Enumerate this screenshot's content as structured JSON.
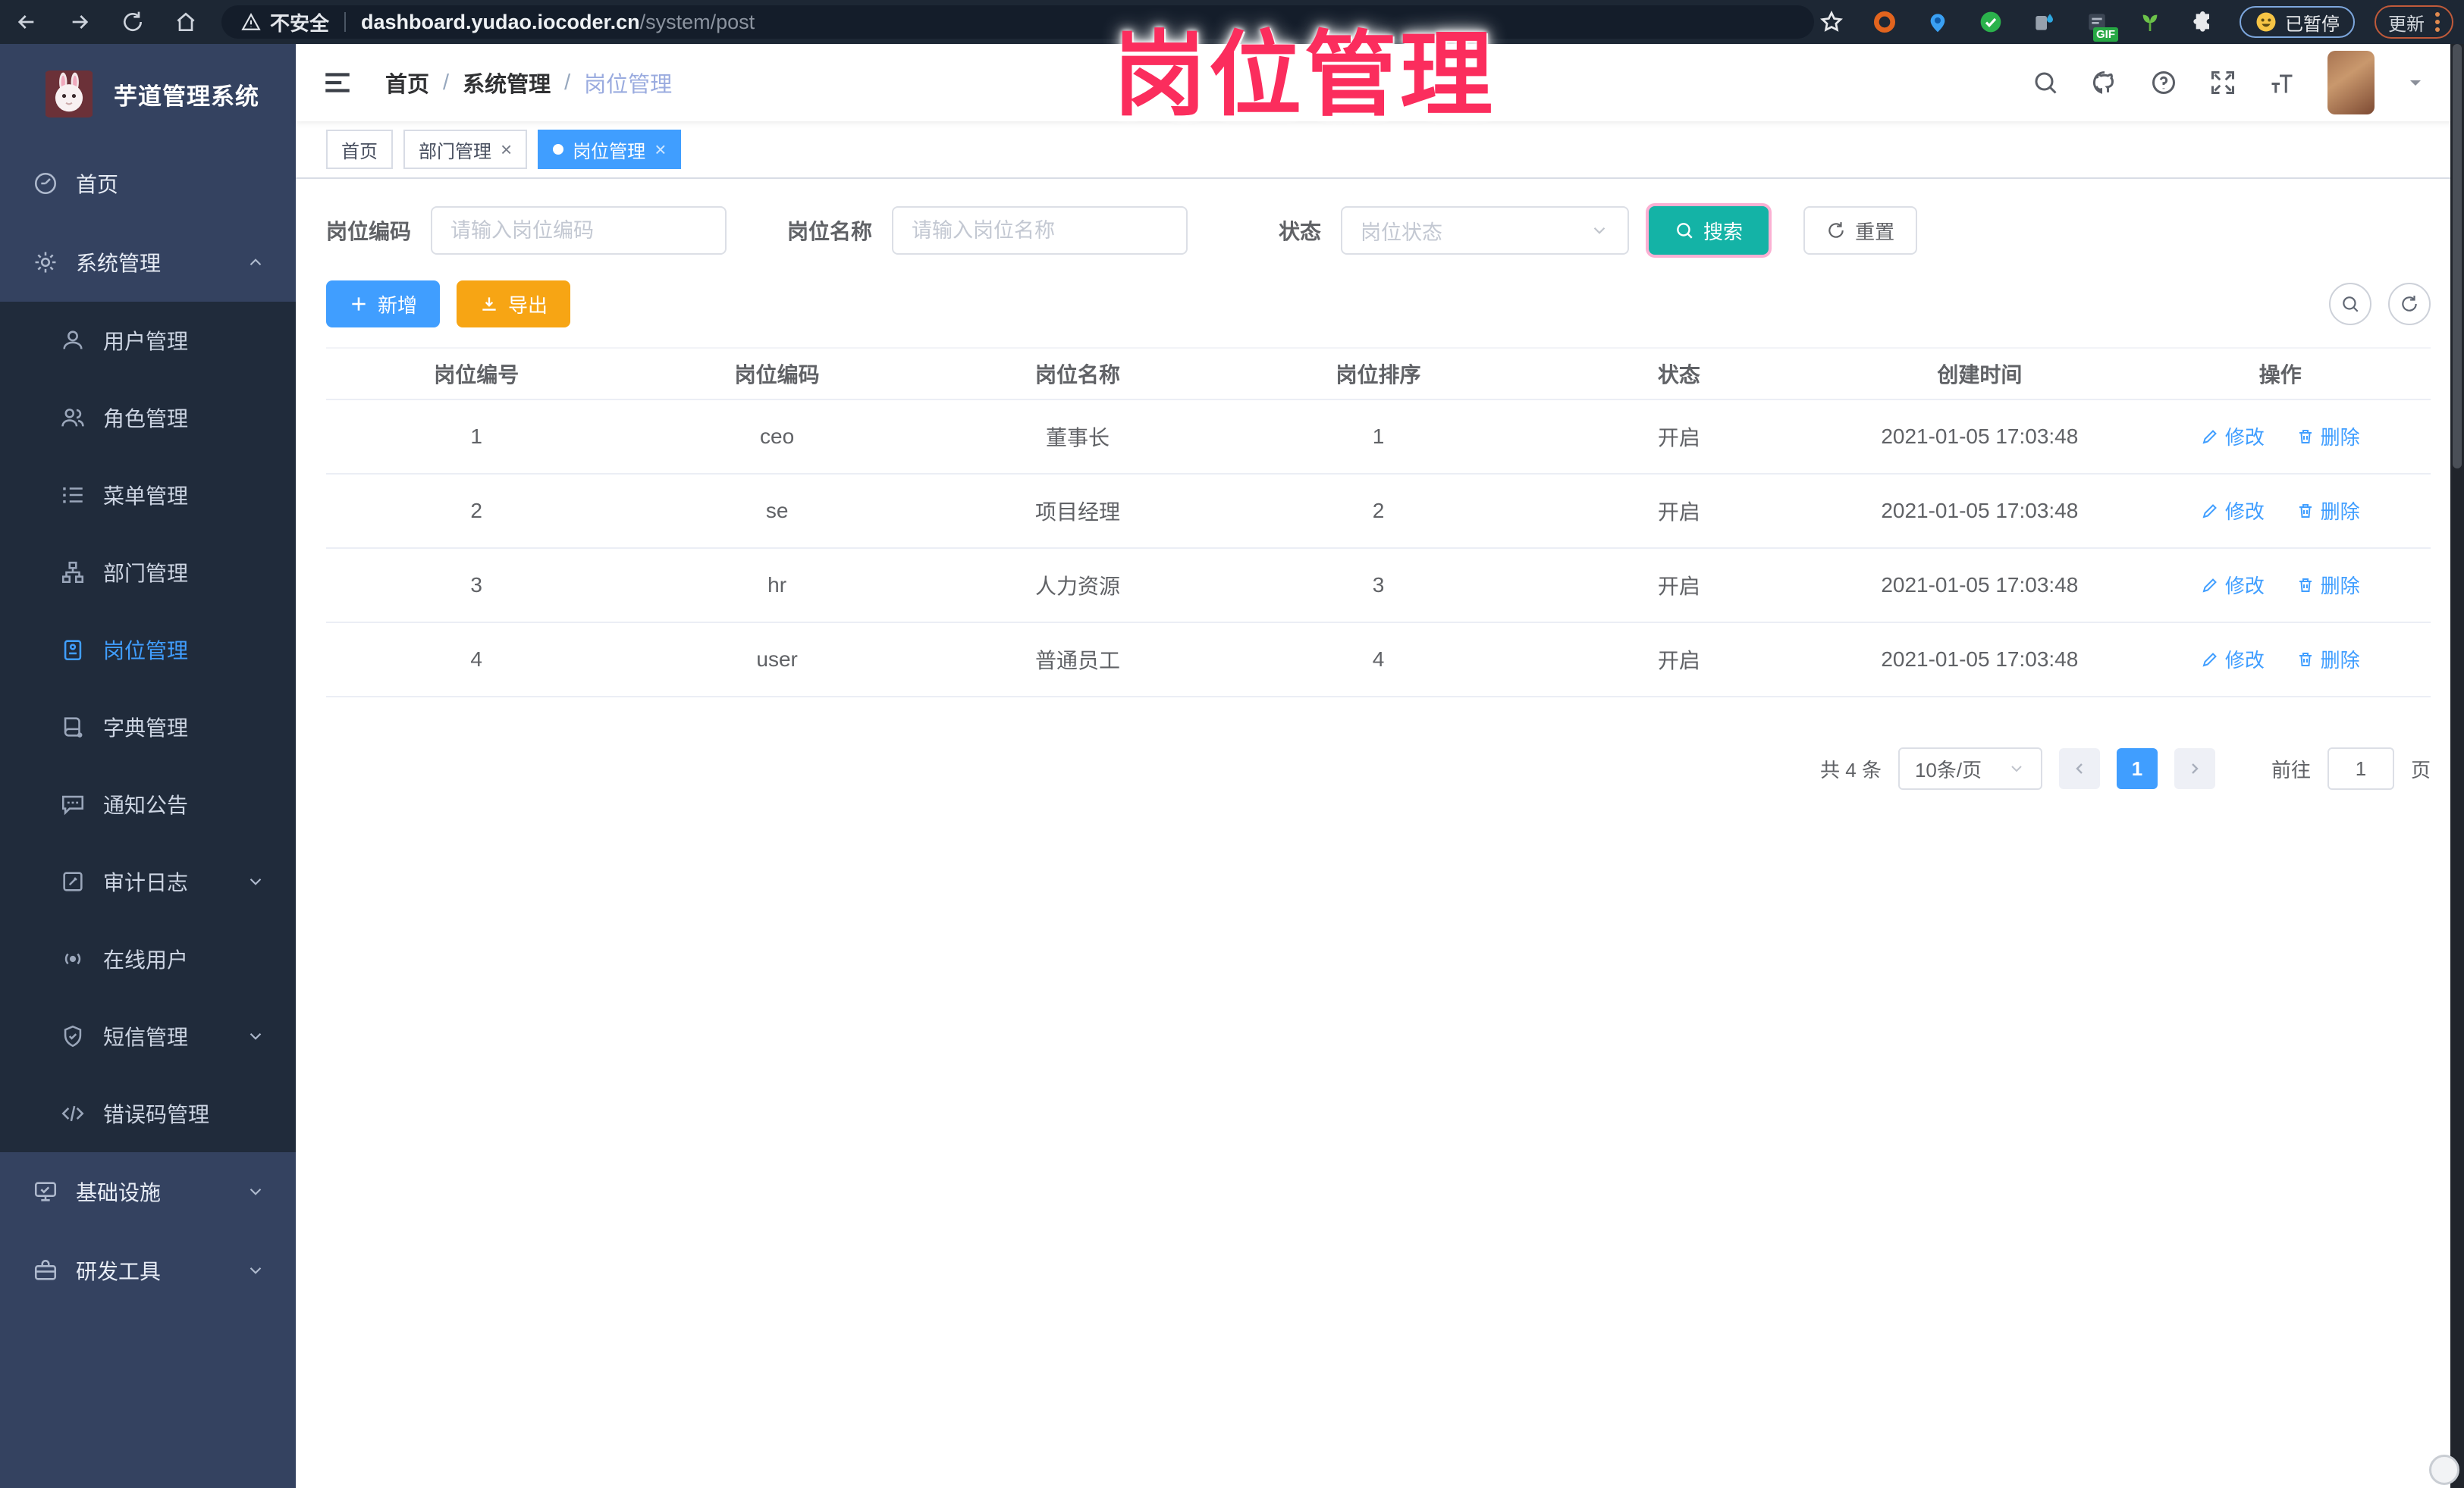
{
  "colors": {
    "accent": "#409eff",
    "teal": "#14b3a6",
    "warning": "#f7a514",
    "overlay_pink": "#fb2d5d",
    "sidebar_bg": "#344260",
    "submenu_bg": "#202b3b"
  },
  "browser": {
    "security_label": "不安全",
    "url_domain": "dashboard.yudao.iocoder.cn",
    "url_path": "/system/post",
    "paused_label": "已暂停",
    "update_label": "更新",
    "gif_badge": "GIF"
  },
  "overlay_title": "岗位管理",
  "sidebar": {
    "app_title": "芋道管理系统",
    "items": [
      {
        "label": "首页"
      },
      {
        "label": "系统管理"
      },
      {
        "label": "用户管理"
      },
      {
        "label": "角色管理"
      },
      {
        "label": "菜单管理"
      },
      {
        "label": "部门管理"
      },
      {
        "label": "岗位管理"
      },
      {
        "label": "字典管理"
      },
      {
        "label": "通知公告"
      },
      {
        "label": "审计日志"
      },
      {
        "label": "在线用户"
      },
      {
        "label": "短信管理"
      },
      {
        "label": "错误码管理"
      },
      {
        "label": "基础设施"
      },
      {
        "label": "研发工具"
      }
    ]
  },
  "header": {
    "breadcrumb": [
      "首页",
      "系统管理",
      "岗位管理"
    ],
    "separator": "/"
  },
  "tabs": [
    {
      "label": "首页"
    },
    {
      "label": "部门管理"
    },
    {
      "label": "岗位管理"
    }
  ],
  "filter": {
    "code_label": "岗位编码",
    "code_placeholder": "请输入岗位编码",
    "name_label": "岗位名称",
    "name_placeholder": "请输入岗位名称",
    "status_label": "状态",
    "status_placeholder": "岗位状态",
    "search_label": "搜索",
    "reset_label": "重置"
  },
  "toolbar": {
    "add_label": "新增",
    "export_label": "导出"
  },
  "table": {
    "columns": [
      "岗位编号",
      "岗位编码",
      "岗位名称",
      "岗位排序",
      "状态",
      "创建时间",
      "操作"
    ],
    "rows": [
      {
        "id": "1",
        "code": "ceo",
        "name": "董事长",
        "sort": "1",
        "status": "开启",
        "time": "2021-01-05 17:03:48"
      },
      {
        "id": "2",
        "code": "se",
        "name": "项目经理",
        "sort": "2",
        "status": "开启",
        "time": "2021-01-05 17:03:48"
      },
      {
        "id": "3",
        "code": "hr",
        "name": "人力资源",
        "sort": "3",
        "status": "开启",
        "time": "2021-01-05 17:03:48"
      },
      {
        "id": "4",
        "code": "user",
        "name": "普通员工",
        "sort": "4",
        "status": "开启",
        "time": "2021-01-05 17:03:48"
      }
    ],
    "edit_label": "修改",
    "delete_label": "删除"
  },
  "pagination": {
    "total": "共 4 条",
    "page_size": "10条/页",
    "current": "1",
    "goto_label": "前往",
    "goto_value": "1",
    "page_unit": "页"
  }
}
